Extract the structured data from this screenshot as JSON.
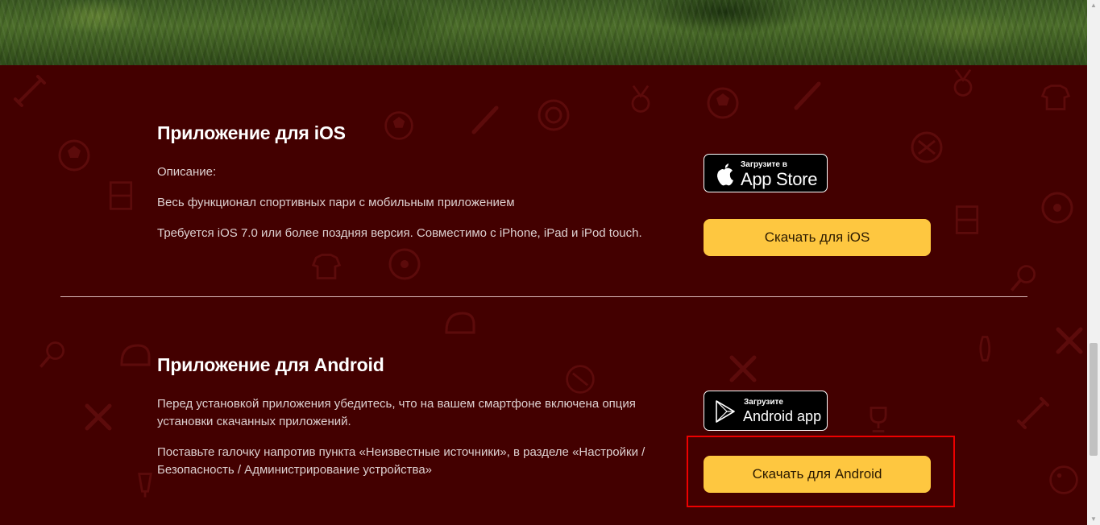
{
  "ios": {
    "title": "Приложение для iOS",
    "description_label": "Описание:",
    "text_1": "Весь функционал спортивных пари с мобильным приложением",
    "text_2": "Требуется iOS 7.0 или более поздняя версия. Совместимо с iPhone, iPad и iPod touch.",
    "badge_small": "Загрузите в",
    "badge_big": "App Store",
    "badge_icon": "apple-icon",
    "button_label": "Скачать для iOS"
  },
  "android": {
    "title": "Приложение для Android",
    "text_1": "Перед установкой приложения убедитесь, что на вашем смартфоне включена опция установки скачанных приложений.",
    "text_2": "Поставьте галочку напротив пункта «Неизвестные источники», в разделе «Настройки / Безопасность / Администрирование устройства»",
    "badge_small": "Загрузите",
    "badge_big": "Android app",
    "badge_icon": "play-store-icon",
    "button_label": "Скачать для Android"
  },
  "colors": {
    "background": "#430000",
    "button": "#fec740",
    "highlight": "#ee0000",
    "pattern": "#5c0a0a"
  }
}
